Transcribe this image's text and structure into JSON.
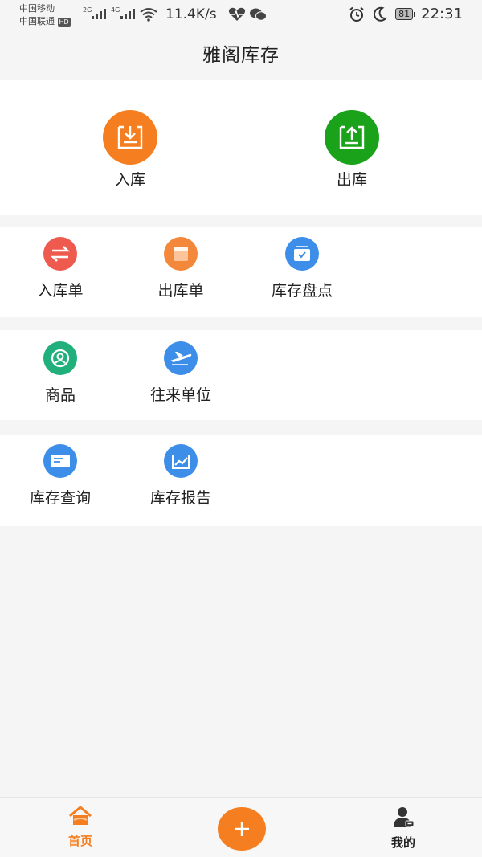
{
  "status_bar": {
    "carrier1": "中国移动",
    "carrier2": "中国联通",
    "hd": "HD",
    "signal1": "2G",
    "signal2": "4G",
    "speed": "11.4K/s",
    "battery": "81",
    "time": "22:31"
  },
  "header": {
    "title": "雅阁库存"
  },
  "main_actions": [
    {
      "label": "入库",
      "color": "#f57f20",
      "icon": "download-tray-icon"
    },
    {
      "label": "出库",
      "color": "#1aa31a",
      "icon": "upload-tray-icon"
    }
  ],
  "menu": {
    "row1": [
      {
        "label": "入库单",
        "color": "#ee5a4e",
        "icon": "exchange-arrows-icon"
      },
      {
        "label": "出库单",
        "color": "#f4883a",
        "icon": "document-icon"
      },
      {
        "label": "库存盘点",
        "color": "#3d8ee8",
        "icon": "checklist-icon"
      }
    ],
    "row2": [
      {
        "label": "商品",
        "color": "#21b07c",
        "icon": "user-circle-icon"
      },
      {
        "label": "往来单位",
        "color": "#3d8ee8",
        "icon": "airplane-icon"
      }
    ],
    "row3": [
      {
        "label": "库存查询",
        "color": "#3d8ee8",
        "icon": "card-icon"
      },
      {
        "label": "库存报告",
        "color": "#3d8ee8",
        "icon": "chart-icon"
      }
    ]
  },
  "bottom_nav": {
    "home": {
      "label": "首页",
      "color": "#f57f20"
    },
    "mine": {
      "label": "我的",
      "color": "#222222"
    },
    "add_color": "#f57f20"
  }
}
